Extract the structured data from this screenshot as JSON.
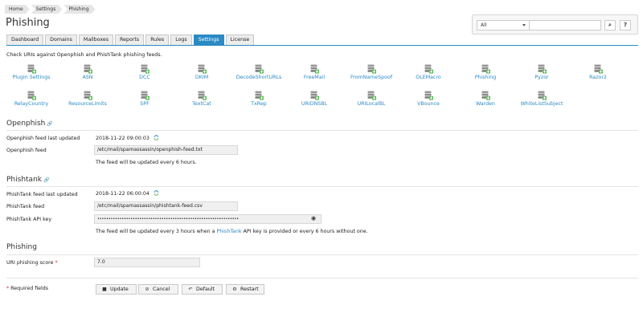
{
  "breadcrumb": [
    "Home",
    "Settings",
    "Phishing"
  ],
  "page_title": "Phishing",
  "search": {
    "select_value": "All",
    "value": "",
    "search_btn": "⌕",
    "help_btn": "?"
  },
  "tabs": [
    {
      "label": "Dashboard",
      "active": false
    },
    {
      "label": "Domains",
      "active": false
    },
    {
      "label": "Mailboxes",
      "active": false
    },
    {
      "label": "Reports",
      "active": false
    },
    {
      "label": "Rules",
      "active": false
    },
    {
      "label": "Logs",
      "active": false
    },
    {
      "label": "Settings",
      "active": true
    },
    {
      "label": "License",
      "active": false
    }
  ],
  "intro": "Check URIs against Openphish and PhishTank phishing feeds.",
  "plugins": [
    [
      "Plugin Settings",
      "ASN",
      "DCC",
      "DKIM",
      "DecodeShortURLs",
      "FreeMail",
      "FromNameSpoof",
      "OLEMacro",
      "Phishing",
      "Pyzor",
      "Razor2"
    ],
    [
      "RelayCountry",
      "ResourceLimits",
      "SPF",
      "TextCat",
      "TxRep",
      "URIDNSBL",
      "URILocalBL",
      "VBounce",
      "Warden",
      "WhiteListSubject"
    ]
  ],
  "openphish": {
    "title": "Openphish",
    "last_updated_label": "Openphish feed last updated",
    "last_updated_value": "2018-11-22 09:00:03",
    "feed_label": "Openphish feed",
    "feed_value": "/etc/mail/spamassassin/openphish-feed.txt",
    "note": "The feed will be updated every 6 hours."
  },
  "phishtank": {
    "title": "Phishtank",
    "last_updated_label": "PhishTank feed last updated",
    "last_updated_value": "2018-11-22 06:00:04",
    "feed_label": "PhishTank feed",
    "feed_value": "/etc/mail/spamassassin/phishtank-feed.csv",
    "api_label": "PhishTank API key",
    "api_value": "••••••••••••••••••••••••••••••••••••••••••••••••••••••••••••••••",
    "note_before": "The feed will be updated every 3 hours when a ",
    "note_link": "PhishTank",
    "note_after": " API key is provided or every 6 hours without one."
  },
  "phishing": {
    "title": "Phishing",
    "score_label": "URI phishing score",
    "score_value": "7.0"
  },
  "footer": {
    "required_label": "Required fields",
    "required_mark": "*",
    "buttons": {
      "update": "Update",
      "cancel": "Cancel",
      "default": "Default",
      "restart": "Restart"
    }
  },
  "colors": {
    "accent": "#2a8ac4",
    "required": "#d9262c",
    "plugin_icon_green": "#5cb85c"
  }
}
